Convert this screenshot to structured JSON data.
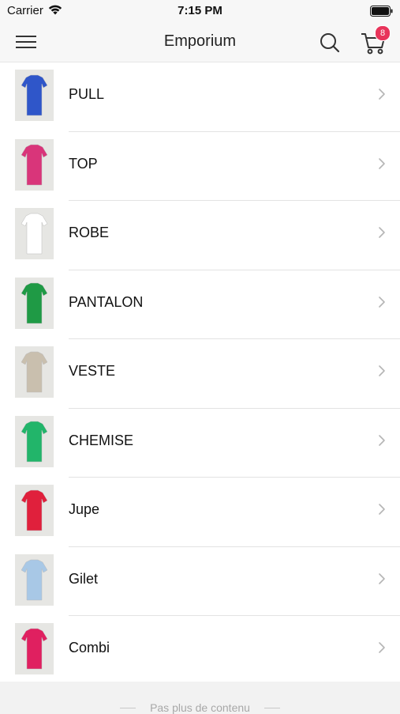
{
  "status_bar": {
    "carrier": "Carrier",
    "time": "7:15 PM"
  },
  "nav": {
    "title": "Emporium",
    "cart_count": "8",
    "badge_color": "#e8345a"
  },
  "categories": [
    {
      "label": "PULL",
      "thumb_color": "#2f56c9"
    },
    {
      "label": "TOP",
      "thumb_color": "#d9357a"
    },
    {
      "label": "ROBE",
      "thumb_color": "#ffffff"
    },
    {
      "label": "PANTALON",
      "thumb_color": "#1f9a45"
    },
    {
      "label": "VESTE",
      "thumb_color": "#c9bfae"
    },
    {
      "label": "CHEMISE",
      "thumb_color": "#22b56a"
    },
    {
      "label": "Jupe",
      "thumb_color": "#e0203c"
    },
    {
      "label": "Gilet",
      "thumb_color": "#a8c8e6"
    },
    {
      "label": "Combi",
      "thumb_color": "#e02060"
    }
  ],
  "footer": {
    "text": "Pas plus de contenu"
  }
}
